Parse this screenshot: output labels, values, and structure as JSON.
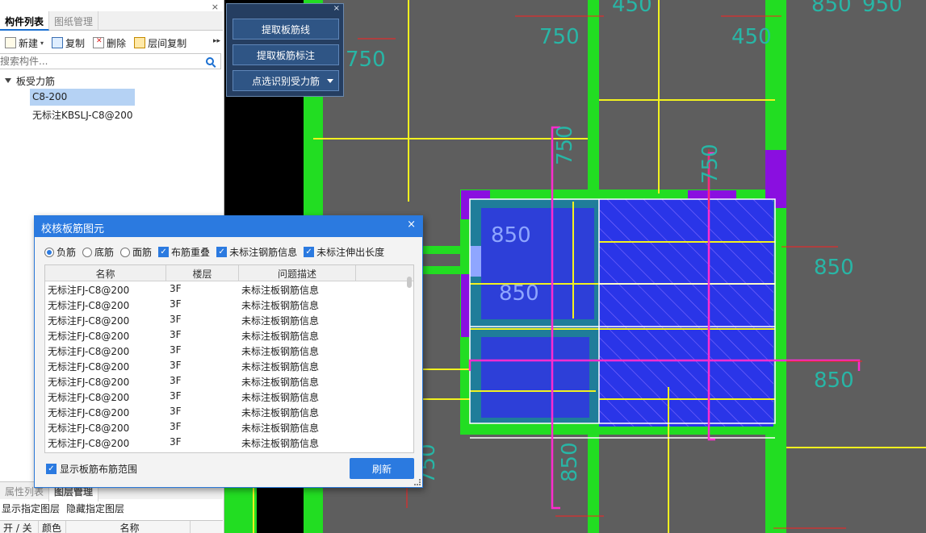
{
  "left_panel": {
    "close_glyph": "×",
    "tabs": [
      "构件列表",
      "图纸管理"
    ],
    "toolbar": {
      "new": "新建",
      "copy": "复制",
      "delete": "删除",
      "floor_copy": "层间复制",
      "more": "▸▸"
    },
    "search_placeholder": "搜索构件...",
    "tree": {
      "root": "板受力筋",
      "items": [
        "C8-200",
        "无标注KBSLJ-C8@200"
      ]
    },
    "bottom_tabs": [
      "属性列表",
      "图层管理"
    ],
    "layer_actions": [
      "显示指定图层",
      "隐藏指定图层"
    ],
    "layer_columns": [
      "开 / 关",
      "颜色",
      "名称"
    ]
  },
  "float_tools": {
    "close_glyph": "×",
    "buttons": [
      "提取板筋线",
      "提取板筋标注",
      "点选识别受力筋"
    ]
  },
  "dialog": {
    "title": "校核板筋图元",
    "close_glyph": "×",
    "radios": [
      {
        "label": "负筋",
        "checked": true
      },
      {
        "label": "底筋",
        "checked": false
      },
      {
        "label": "面筋",
        "checked": false
      }
    ],
    "checks": [
      "布筋重叠",
      "未标注钢筋信息",
      "未标注伸出长度"
    ],
    "columns": [
      "名称",
      "楼层",
      "问题描述"
    ],
    "rows": [
      [
        "无标注FJ-C8@200",
        "3F",
        "未标注板钢筋信息"
      ],
      [
        "无标注FJ-C8@200",
        "3F",
        "未标注板钢筋信息"
      ],
      [
        "无标注FJ-C8@200",
        "3F",
        "未标注板钢筋信息"
      ],
      [
        "无标注FJ-C8@200",
        "3F",
        "未标注板钢筋信息"
      ],
      [
        "无标注FJ-C8@200",
        "3F",
        "未标注板钢筋信息"
      ],
      [
        "无标注FJ-C8@200",
        "3F",
        "未标注板钢筋信息"
      ],
      [
        "无标注FJ-C8@200",
        "3F",
        "未标注板钢筋信息"
      ],
      [
        "无标注FJ-C8@200",
        "3F",
        "未标注板钢筋信息"
      ],
      [
        "无标注FJ-C8@200",
        "3F",
        "未标注板钢筋信息"
      ],
      [
        "无标注FJ-C8@200",
        "3F",
        "未标注板钢筋信息"
      ],
      [
        "无标注FJ-C8@200",
        "3F",
        "未标注板钢筋信息"
      ]
    ],
    "show_range_label": "显示板筋布筋范围",
    "refresh_label": "刷新"
  },
  "canvas": {
    "dim_labels": [
      "450",
      "850",
      "750",
      "450",
      "750",
      "750",
      "750",
      "850",
      "850",
      "850",
      "850",
      "850",
      "750",
      "950"
    ]
  }
}
